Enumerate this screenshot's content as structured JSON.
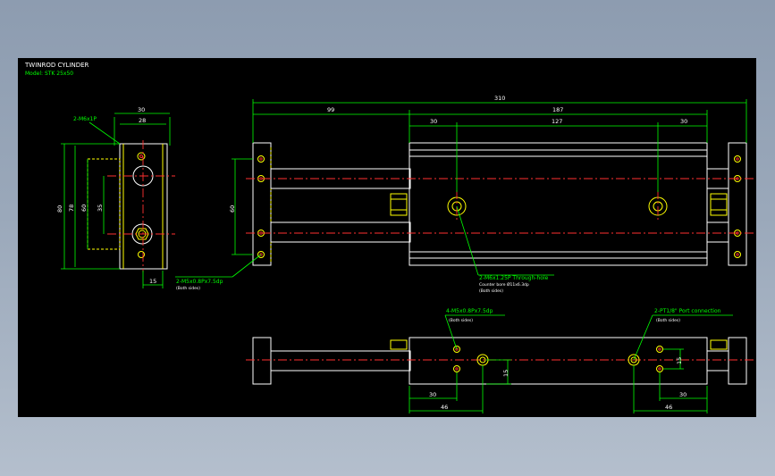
{
  "title": {
    "line1": "TWINROD CYLINDER",
    "line2": "Model: STK 25x50"
  },
  "colors": {
    "background": "#000000",
    "outline": "#ffffff",
    "hidden": "#ffff00",
    "dimension": "#00ff00",
    "centerline": "#ff3030"
  },
  "side_view": {
    "dims": {
      "top_30": "30",
      "top_28": "28",
      "h_80": "80",
      "h_78": "78",
      "h_60": "60",
      "h_35": "35",
      "w_15": "15"
    },
    "note_thread": "2-M6x1P"
  },
  "front_view": {
    "dims": {
      "total": "310",
      "d99": "99",
      "d187": "187",
      "d30a": "30",
      "d127": "127",
      "d30b": "30",
      "h60": "60"
    },
    "note_end": "2-M5x0.8Px7.5dp",
    "note_end_sub": "(Both sides)",
    "note_mount": "2-M6x1.25P Through-hole",
    "note_mount_2": "Counter bore Ø11x6.3dp",
    "note_mount_sub": "(Both sides)"
  },
  "bottom_view": {
    "dims": {
      "d30": "30",
      "d46": "46",
      "d15": "15",
      "d30r": "30",
      "d46r": "46",
      "d15r": "15"
    },
    "note_tap": "4-M5x0.8Px7.5dp",
    "note_tap_sub": "(Both sides)",
    "note_port": "2-PT1/8\" Port connection",
    "note_port_sub": "(Both sides)"
  }
}
